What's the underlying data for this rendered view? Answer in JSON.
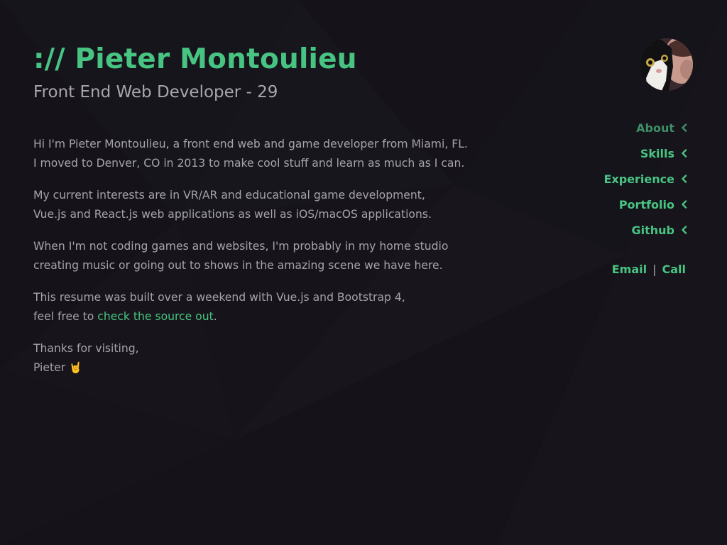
{
  "header": {
    "title": ":// Pieter Montoulieu",
    "subtitle": "Front End Web Developer - 29"
  },
  "bio": {
    "p1_line1": "Hi I'm Pieter Montoulieu, a front end web and game developer from Miami, FL.",
    "p1_line2": "I moved to Denver, CO in 2013 to make cool stuff and learn as much as I can.",
    "p2_line1": "My current interests are in VR/AR and educational game development,",
    "p2_line2": "Vue.js and React.js web applications as well as iOS/macOS applications.",
    "p3_line1": "When I'm not coding games and websites, I'm probably in my home studio",
    "p3_line2": "creating music or going out to shows in the amazing scene we have here.",
    "p4_line1": "This resume was built over a weekend with Vue.js and Bootstrap 4,",
    "p4_line2_prefix": "feel free to ",
    "p4_link": "check the source out",
    "p4_line2_suffix": ".",
    "p5_line1": "Thanks for visiting,",
    "p5_line2": "Pieter",
    "p5_emoji": "🤘"
  },
  "nav": {
    "items": [
      {
        "label": "About",
        "active": true
      },
      {
        "label": "Skills"
      },
      {
        "label": "Experience"
      },
      {
        "label": "Portfolio"
      },
      {
        "label": "Github"
      }
    ]
  },
  "contact": {
    "email": "Email",
    "separator": "|",
    "call": "Call"
  },
  "colors": {
    "accent": "#48c482",
    "accent_active": "#3f8f68",
    "text": "#a6a3ab",
    "background": "#141219"
  },
  "icons": {
    "nav_chevron": "chevron-left-icon",
    "avatar": "profile-photo-avatar"
  }
}
